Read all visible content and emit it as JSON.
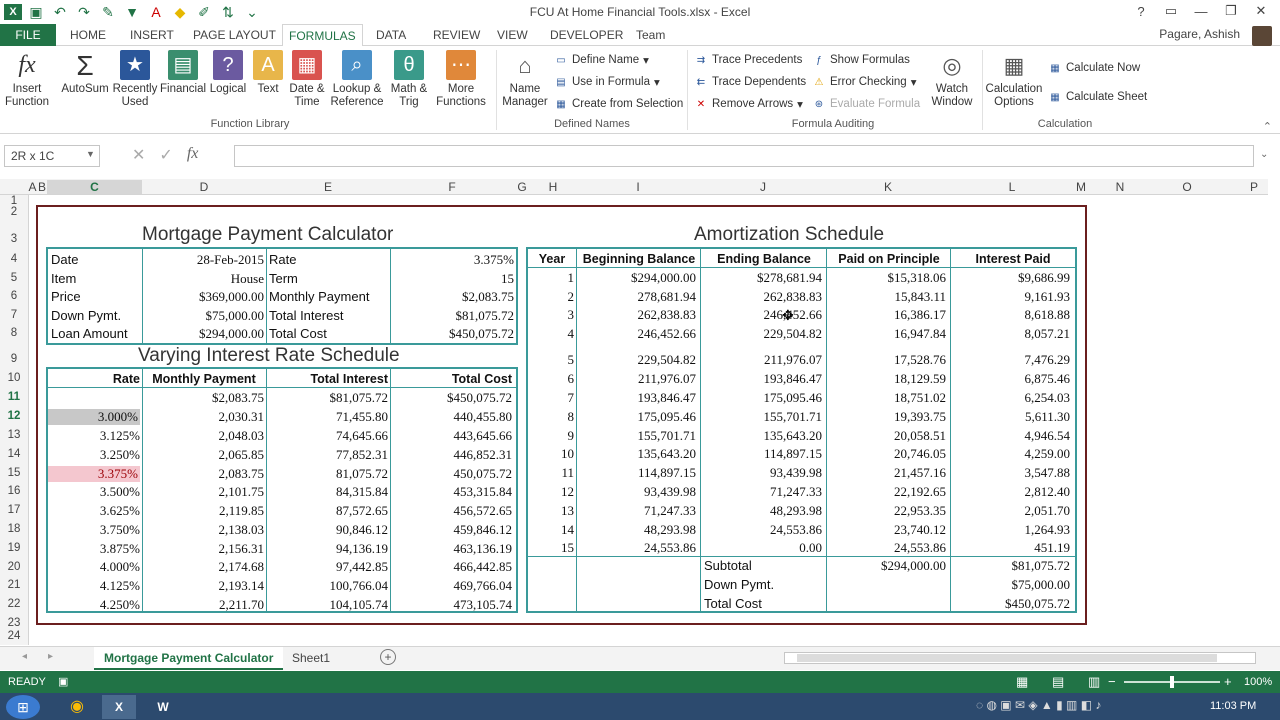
{
  "app": {
    "title": "FCU At Home Financial Tools.xlsx - Excel",
    "user": "Pagare, Ashish"
  },
  "tabs": [
    "FILE",
    "HOME",
    "INSERT",
    "PAGE LAYOUT",
    "FORMULAS",
    "DATA",
    "REVIEW",
    "VIEW",
    "DEVELOPER",
    "Team"
  ],
  "ribbon": {
    "function_library": {
      "label": "Function Library",
      "buttons": [
        "Insert Function",
        "AutoSum",
        "Recently Used",
        "Financial",
        "Logical",
        "Text",
        "Date & Time",
        "Lookup & Reference",
        "Math & Trig",
        "More Functions"
      ]
    },
    "defined_names": {
      "label": "Defined Names",
      "name_manager": "Name Manager",
      "define_name": "Define Name",
      "use_in_formula": "Use in Formula",
      "create_from_selection": "Create from Selection"
    },
    "formula_auditing": {
      "label": "Formula Auditing",
      "trace_precedents": "Trace Precedents",
      "trace_dependents": "Trace Dependents",
      "remove_arrows": "Remove Arrows",
      "show_formulas": "Show Formulas",
      "error_checking": "Error Checking",
      "evaluate_formula": "Evaluate Formula",
      "watch_window": "Watch Window"
    },
    "calculation": {
      "label": "Calculation",
      "options": "Calculation Options",
      "calc_now": "Calculate Now",
      "calc_sheet": "Calculate Sheet"
    }
  },
  "formula_bar": {
    "name_box": "2R x 1C",
    "formula": ""
  },
  "columns": [
    "A",
    "B",
    "C",
    "D",
    "E",
    "F",
    "G",
    "H",
    "I",
    "J",
    "K",
    "L",
    "M",
    "N",
    "O",
    "P"
  ],
  "rows": [
    "1",
    "2",
    "3",
    "4",
    "5",
    "6",
    "7",
    "8",
    "9",
    "10",
    "11",
    "12",
    "13",
    "14",
    "15",
    "16",
    "17",
    "18",
    "19",
    "20",
    "21",
    "22",
    "23",
    "24"
  ],
  "calculator": {
    "title": "Mortgage Payment Calculator",
    "left": [
      [
        "Date",
        "28-Feb-2015"
      ],
      [
        "Item",
        "House"
      ],
      [
        "Price",
        "$369,000.00"
      ],
      [
        "Down Pymt.",
        "$75,000.00"
      ],
      [
        "Loan Amount",
        "$294,000.00"
      ]
    ],
    "right": [
      [
        "Rate",
        "3.375%"
      ],
      [
        "Term",
        "15"
      ],
      [
        "Monthly Payment",
        "$2,083.75"
      ],
      [
        "Total Interest",
        "$81,075.72"
      ],
      [
        "Total Cost",
        "$450,075.72"
      ]
    ]
  },
  "varying": {
    "title": "Varying Interest Rate Schedule",
    "headers": [
      "Rate",
      "Monthly Payment",
      "Total Interest",
      "Total Cost"
    ],
    "rows": [
      [
        "",
        "$2,083.75",
        "$81,075.72",
        "$450,075.72"
      ],
      [
        "3.000%",
        "2,030.31",
        "71,455.80",
        "440,455.80"
      ],
      [
        "3.125%",
        "2,048.03",
        "74,645.66",
        "443,645.66"
      ],
      [
        "3.250%",
        "2,065.85",
        "77,852.31",
        "446,852.31"
      ],
      [
        "3.375%",
        "2,083.75",
        "81,075.72",
        "450,075.72"
      ],
      [
        "3.500%",
        "2,101.75",
        "84,315.84",
        "453,315.84"
      ],
      [
        "3.625%",
        "2,119.85",
        "87,572.65",
        "456,572.65"
      ],
      [
        "3.750%",
        "2,138.03",
        "90,846.12",
        "459,846.12"
      ],
      [
        "3.875%",
        "2,156.31",
        "94,136.19",
        "463,136.19"
      ],
      [
        "4.000%",
        "2,174.68",
        "97,442.85",
        "466,442.85"
      ],
      [
        "4.125%",
        "2,193.14",
        "100,766.04",
        "469,766.04"
      ],
      [
        "4.250%",
        "2,211.70",
        "104,105.74",
        "473,105.74"
      ]
    ]
  },
  "amort": {
    "title": "Amortization Schedule",
    "headers": [
      "Year",
      "Beginning Balance",
      "Ending Balance",
      "Paid on Principle",
      "Interest Paid"
    ],
    "rows": [
      [
        "1",
        "$294,000.00",
        "$278,681.94",
        "$15,318.06",
        "$9,686.99"
      ],
      [
        "2",
        "278,681.94",
        "262,838.83",
        "15,843.11",
        "9,161.93"
      ],
      [
        "3",
        "262,838.83",
        "246,452.66",
        "16,386.17",
        "8,618.88"
      ],
      [
        "4",
        "246,452.66",
        "229,504.82",
        "16,947.84",
        "8,057.21"
      ],
      [
        "5",
        "229,504.82",
        "211,976.07",
        "17,528.76",
        "7,476.29"
      ],
      [
        "6",
        "211,976.07",
        "193,846.47",
        "18,129.59",
        "6,875.46"
      ],
      [
        "7",
        "193,846.47",
        "175,095.46",
        "18,751.02",
        "6,254.03"
      ],
      [
        "8",
        "175,095.46",
        "155,701.71",
        "19,393.75",
        "5,611.30"
      ],
      [
        "9",
        "155,701.71",
        "135,643.20",
        "20,058.51",
        "4,946.54"
      ],
      [
        "10",
        "135,643.20",
        "114,897.15",
        "20,746.05",
        "4,259.00"
      ],
      [
        "11",
        "114,897.15",
        "93,439.98",
        "21,457.16",
        "3,547.88"
      ],
      [
        "12",
        "93,439.98",
        "71,247.33",
        "22,192.65",
        "2,812.40"
      ],
      [
        "13",
        "71,247.33",
        "48,293.98",
        "22,953.35",
        "2,051.70"
      ],
      [
        "14",
        "48,293.98",
        "24,553.86",
        "23,740.12",
        "1,264.93"
      ],
      [
        "15",
        "24,553.86",
        "0.00",
        "24,553.86",
        "451.19"
      ]
    ],
    "subtotal_label": "Subtotal",
    "subtotal_principle": "$294,000.00",
    "subtotal_interest": "$81,075.72",
    "down_label": "Down Pymt.",
    "down_value": "$75,000.00",
    "total_label": "Total Cost",
    "total_value": "$450,075.72"
  },
  "sheets": [
    "Mortgage Payment Calculator",
    "Sheet1"
  ],
  "status": {
    "ready": "READY",
    "zoom": "100%"
  },
  "taskbar": {
    "time": "11:03 PM"
  }
}
